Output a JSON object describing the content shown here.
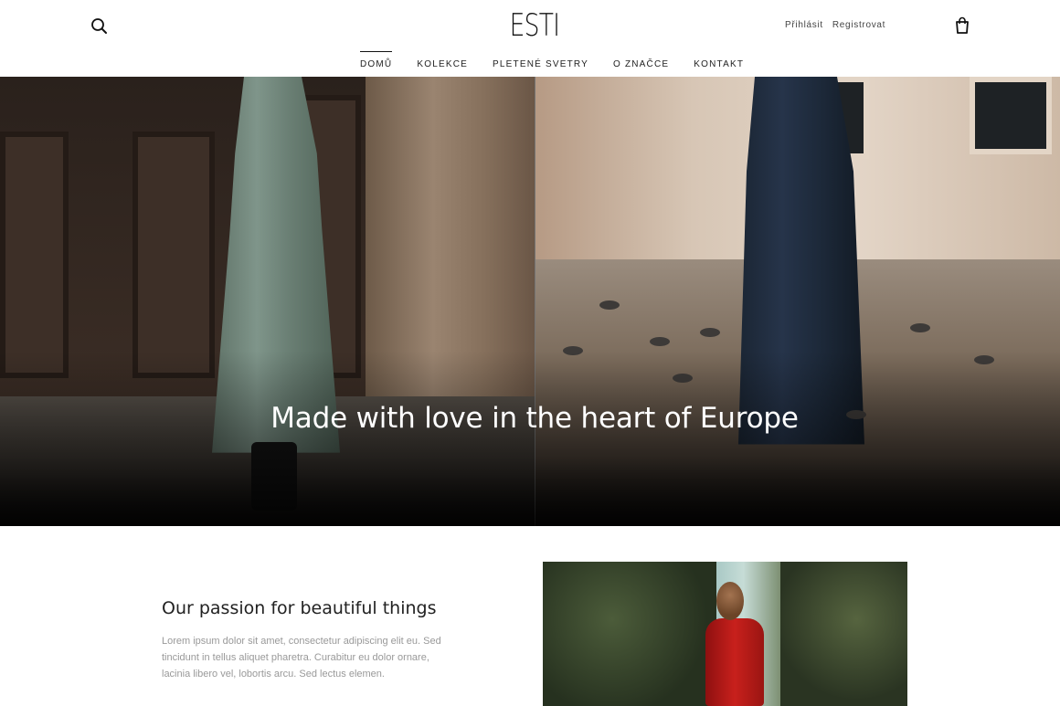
{
  "header": {
    "logo_text": "ESTI",
    "login_label": "Přihlásit",
    "register_label": "Registrovat"
  },
  "nav": {
    "items": [
      {
        "label": "DOMŮ",
        "active": true
      },
      {
        "label": "KOLEKCE",
        "active": false
      },
      {
        "label": "PLETENÉ SVETRY",
        "active": false
      },
      {
        "label": "O ZNAČCE",
        "active": false
      },
      {
        "label": "KONTAKT",
        "active": false
      }
    ]
  },
  "hero": {
    "title": "Made with love in the heart of Europe"
  },
  "about": {
    "title": "Our passion for beautiful things",
    "text": "Lorem ipsum dolor sit amet, consectetur adipiscing elit eu. Sed tincidunt in tellus aliquet pharetra. Curabitur eu dolor ornare, lacinia libero vel, lobortis arcu. Sed lectus elemen."
  },
  "icons": {
    "search": "search-icon",
    "cart": "shopping-bag-icon"
  }
}
